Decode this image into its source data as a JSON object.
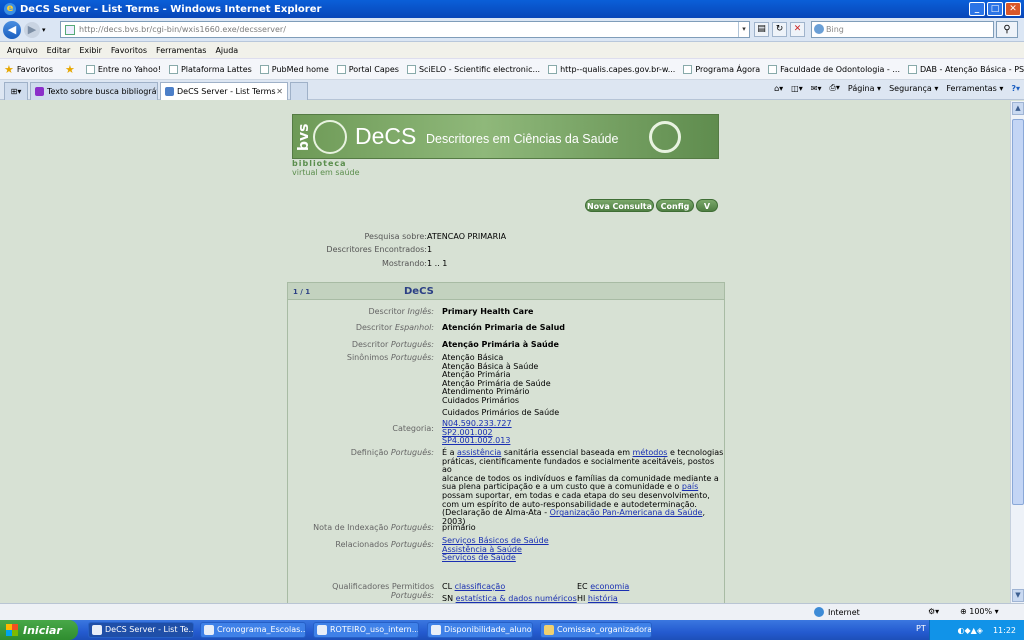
{
  "window": {
    "title": "DeCS Server - List Terms - Windows Internet Explorer"
  },
  "address": {
    "url": "http://decs.bvs.br/cgi-bin/wxis1660.exe/decsserver/",
    "search_placeholder": "Bing"
  },
  "menu": [
    "Arquivo",
    "Editar",
    "Exibir",
    "Favoritos",
    "Ferramentas",
    "Ajuda"
  ],
  "favorites": {
    "label": "Favoritos",
    "items": [
      "Entre no Yahoo!",
      "Plataforma Lattes",
      "PubMed home",
      "Portal Capes",
      "SciELO - Scientific electronic...",
      "http--qualis.capes.gov.br-w...",
      "Programa Ágora",
      "Faculdade de Odontologia - ...",
      "DAB - Atenção Básica - PSF ..."
    ]
  },
  "tabs": [
    {
      "label": "Texto sobre busca bibliográfi..."
    },
    {
      "label": "DeCS Server - List Terms"
    }
  ],
  "tab_tools": {
    "pagina": "Página",
    "seguranca": "Segurança",
    "ferramentas": "Ferramentas"
  },
  "banner": {
    "bvs": "bvs",
    "decs": "DeCS",
    "subtitle": "Descritores em Ciências da Saúde",
    "biblio1": "biblioteca",
    "biblio2": "virtual em saúde"
  },
  "buttons": {
    "nova": "Nova Consulta",
    "config": "Config",
    "v": "V"
  },
  "query": {
    "pesquisa_k": "Pesquisa sobre:",
    "pesquisa_v": "ATENCAO PRIMARIA",
    "encontrados_k": "Descritores Encontrados:",
    "encontrados_v": "1",
    "mostrando_k": "Mostrando:",
    "mostrando_v": "1 .. 1"
  },
  "result": {
    "num": "1 / 1",
    "title": "DeCS",
    "ingles_lbl": "Descritor",
    "ingles_lang": "Inglês:",
    "ingles": "Primary Health Care",
    "espanhol_lbl": "Descritor",
    "espanhol_lang": "Espanhol:",
    "espanhol": "Atención Primaria de Salud",
    "portugues_lbl": "Descritor",
    "portugues_lang": "Português:",
    "portugues": "Atenção Primária à Saúde",
    "sin_lbl": "Sinônimos",
    "sin_lang": "Português:",
    "sinonimos": [
      "Atenção Básica",
      "Atenção Básica à Saúde",
      "Atenção Primária",
      "Atenção Primária de Saúde",
      "Atendimento Primário",
      "Cuidados Primários"
    ],
    "sinonimo_extra": "Cuidados Primários de Saúde",
    "cat_lbl": "Categoria:",
    "categorias": [
      "N04.590.233.727",
      "SP2.001.002",
      "SP4.001.002.013"
    ],
    "def_lbl": "Definição",
    "def_lang": "Português:",
    "def_lines": [
      [
        "É a ",
        "assistência",
        " sanitária essencial baseada em ",
        "métodos",
        " e tecnologias"
      ],
      [
        "práticas, cientificamente fundados e socialmente aceitáveis, postos ao"
      ],
      [
        "alcance de todos os indivíduos e famílias da comunidade mediante a"
      ],
      [
        "sua plena participação e a um custo que a comunidade e o ",
        "país"
      ],
      [
        "possam suportar, em todas e cada etapa do seu desenvolvimento,"
      ],
      [
        "com um espírito de auto-responsabilidade e autodeterminação."
      ],
      [
        "(Declaração de Alma-Ata - ",
        "Organização Pan-Americana da Saúde",
        ","
      ],
      [
        "2003)"
      ]
    ],
    "nota_lbl": "Nota de Indexação",
    "nota_lang": "Português:",
    "nota": "primário",
    "rel_lbl": "Relacionados",
    "rel_lang": "Português:",
    "relacionados": [
      "Serviços Básicos de Saúde",
      "Assistência à Saúde",
      "Serviços de Saúde"
    ],
    "qual_lbl": "Qualificadores Permitidos",
    "qual_lang": "Português:",
    "q1_code": "CL",
    "q1": "classificação",
    "q2_code": "EC",
    "q2": "economia",
    "q3_code": "SN",
    "q3": "estatística & dados numéricos",
    "q4_code": "HI",
    "q4": "história"
  },
  "status": {
    "zone": "Internet",
    "zoom": "100%"
  },
  "taskbar": {
    "start": "Iniciar",
    "tasks": [
      "DeCS Server - List Te...",
      "Cronograma_Escolas...",
      "ROTEIRO_uso_intern...",
      "Disponibilidade_aluno...",
      "Comissao_organizadora"
    ],
    "lang": "PT",
    "clock": "11:22"
  }
}
